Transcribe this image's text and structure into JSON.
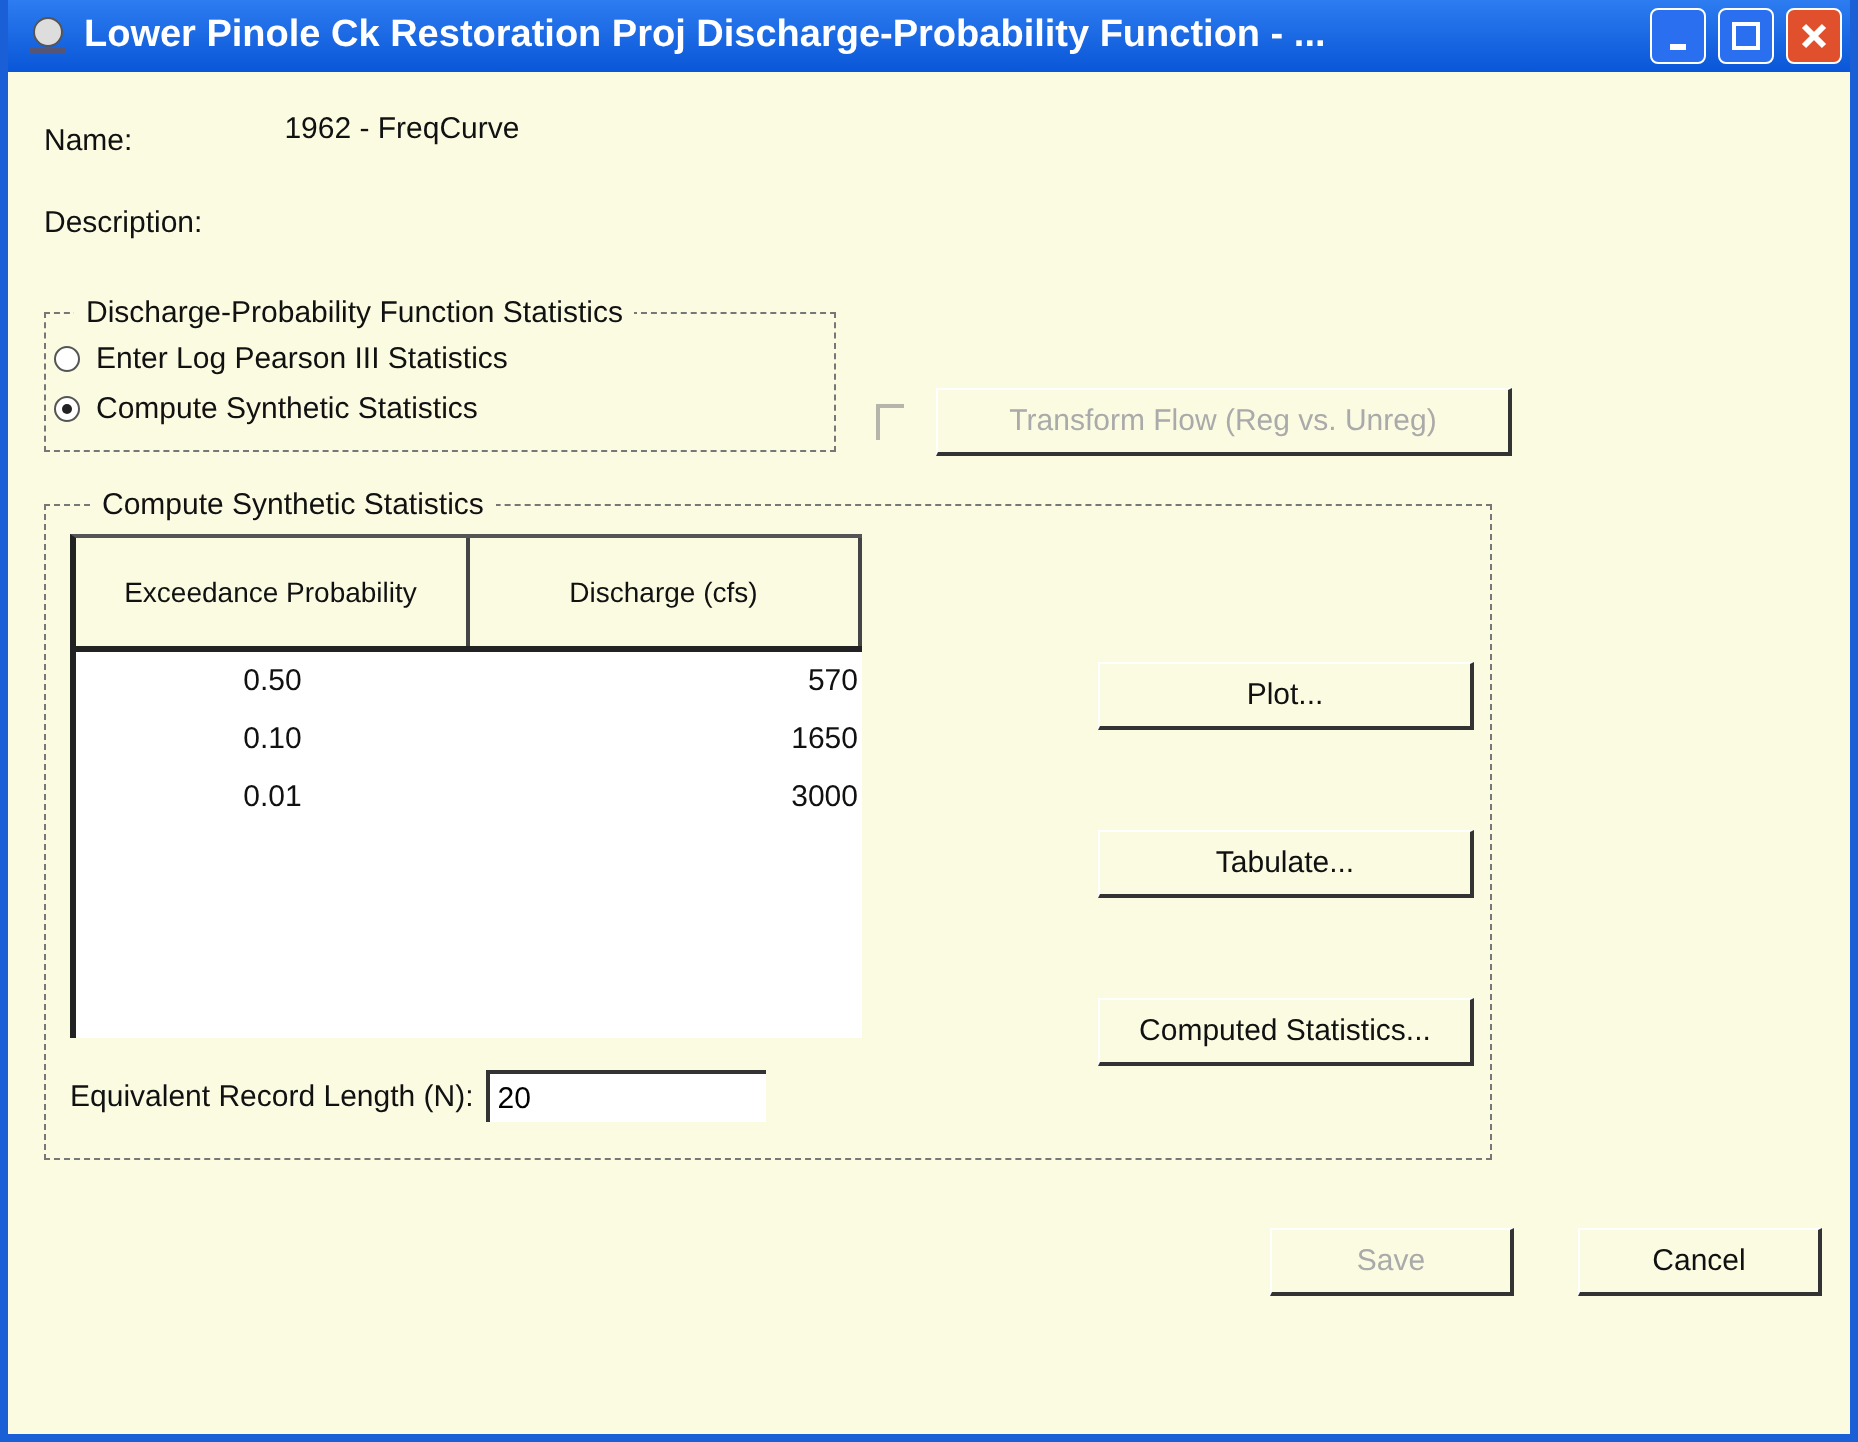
{
  "window": {
    "title": "Lower Pinole Ck Restoration Proj   Discharge-Probability Function - ..."
  },
  "name": {
    "label": "Name:",
    "value": "1962 - FreqCurve"
  },
  "description": {
    "label": "Description:"
  },
  "statistics_group": {
    "title": "Discharge-Probability Function Statistics",
    "options": [
      {
        "label": "Enter Log Pearson III Statistics",
        "selected": false
      },
      {
        "label": "Compute Synthetic Statistics",
        "selected": true
      }
    ]
  },
  "transform": {
    "checked": false,
    "disabled": true,
    "button": {
      "label": "Transform Flow (Reg vs. Unreg)",
      "disabled": true
    }
  },
  "synthetic_group": {
    "title": "Compute Synthetic Statistics",
    "table": {
      "columns": [
        "Exceedance Probability",
        "Discharge (cfs)"
      ],
      "rows": [
        [
          "0.50",
          "570"
        ],
        [
          "0.10",
          "1650"
        ],
        [
          "0.01",
          "3000"
        ]
      ]
    },
    "record_length": {
      "label": "Equivalent Record Length (N):",
      "value": "20"
    },
    "buttons": [
      {
        "label": "Plot...",
        "disabled": false
      },
      {
        "label": "Tabulate...",
        "disabled": false
      },
      {
        "label": "Computed Statistics...",
        "disabled": false
      }
    ]
  },
  "footer_buttons": [
    {
      "label": "Save",
      "disabled": true
    },
    {
      "label": "Cancel",
      "disabled": false
    }
  ]
}
